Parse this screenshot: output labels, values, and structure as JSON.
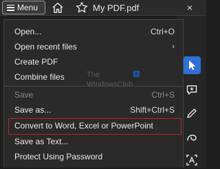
{
  "titlebar": {
    "menu_label": "Menu",
    "doc_title": "My PDF.pdf",
    "close_glyph": "×"
  },
  "menu": {
    "items": [
      {
        "label": "Open...",
        "shortcut": "Ctrl+O",
        "enabled": true
      },
      {
        "label": "Open recent files",
        "shortcut": "›",
        "enabled": true
      },
      {
        "label": "Create PDF",
        "shortcut": "",
        "enabled": true
      },
      {
        "label": "Combine files",
        "shortcut": "",
        "enabled": true
      },
      {
        "label": "Save",
        "shortcut": "Ctrl+S",
        "enabled": false
      },
      {
        "label": "Save as...",
        "shortcut": "Shift+Ctrl+S",
        "enabled": true
      },
      {
        "label": "Convert to Word, Excel or PowerPoint",
        "shortcut": "",
        "enabled": true,
        "highlighted": true
      },
      {
        "label": "Save as Text...",
        "shortcut": "",
        "enabled": true
      },
      {
        "label": "Protect Using Password",
        "shortcut": "",
        "enabled": true
      }
    ]
  },
  "watermark": {
    "line1": "The",
    "line2": "WindowsClub"
  },
  "colors": {
    "accent": "#2f6fd6",
    "highlight_border": "#c0202a",
    "menu_bg": "#2a2a2a"
  },
  "toolbar_icons": [
    "select-arrow-icon",
    "add-comment-icon",
    "pen-icon",
    "curve-draw-icon",
    "text-recognition-icon"
  ]
}
